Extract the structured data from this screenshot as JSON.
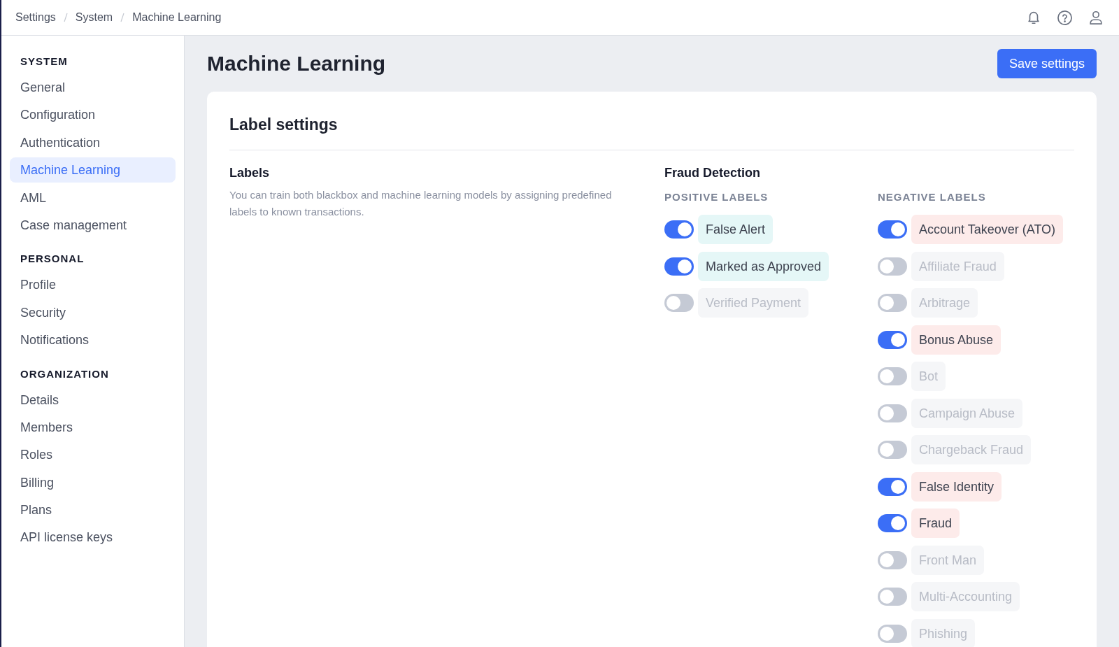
{
  "breadcrumb": [
    "Settings",
    "System",
    "Machine Learning"
  ],
  "sidebar": {
    "sections": [
      {
        "title": "SYSTEM",
        "items": [
          {
            "label": "General",
            "selected": false
          },
          {
            "label": "Configuration",
            "selected": false
          },
          {
            "label": "Authentication",
            "selected": false
          },
          {
            "label": "Machine Learning",
            "selected": true
          },
          {
            "label": "AML",
            "selected": false
          },
          {
            "label": "Case management",
            "selected": false
          }
        ]
      },
      {
        "title": "PERSONAL",
        "items": [
          {
            "label": "Profile",
            "selected": false
          },
          {
            "label": "Security",
            "selected": false
          },
          {
            "label": "Notifications",
            "selected": false
          }
        ]
      },
      {
        "title": "ORGANIZATION",
        "items": [
          {
            "label": "Details",
            "selected": false
          },
          {
            "label": "Members",
            "selected": false
          },
          {
            "label": "Roles",
            "selected": false
          },
          {
            "label": "Billing",
            "selected": false
          },
          {
            "label": "Plans",
            "selected": false
          },
          {
            "label": "API license keys",
            "selected": false
          }
        ]
      }
    ]
  },
  "page_title": "Machine Learning",
  "save_button": "Save settings",
  "card": {
    "title": "Label settings",
    "labels_heading": "Labels",
    "labels_description": "You can train both blackbox and machine learning models by assigning predefined labels to known transactions.",
    "group_title": "Fraud Detection",
    "columns": [
      {
        "kind": "positive",
        "title": "POSITIVE LABELS",
        "labels": [
          {
            "label": "False Alert",
            "on": true
          },
          {
            "label": "Marked as Approved",
            "on": true
          },
          {
            "label": "Verified Payment",
            "on": false
          }
        ]
      },
      {
        "kind": "negative",
        "title": "NEGATIVE LABELS",
        "labels": [
          {
            "label": "Account Takeover (ATO)",
            "on": true
          },
          {
            "label": "Affiliate Fraud",
            "on": false
          },
          {
            "label": "Arbitrage",
            "on": false
          },
          {
            "label": "Bonus Abuse",
            "on": true
          },
          {
            "label": "Bot",
            "on": false
          },
          {
            "label": "Campaign Abuse",
            "on": false
          },
          {
            "label": "Chargeback Fraud",
            "on": false
          },
          {
            "label": "False Identity",
            "on": true
          },
          {
            "label": "Fraud",
            "on": true
          },
          {
            "label": "Front Man",
            "on": false
          },
          {
            "label": "Multi-Accounting",
            "on": false
          },
          {
            "label": "Phishing",
            "on": false
          }
        ]
      }
    ]
  }
}
